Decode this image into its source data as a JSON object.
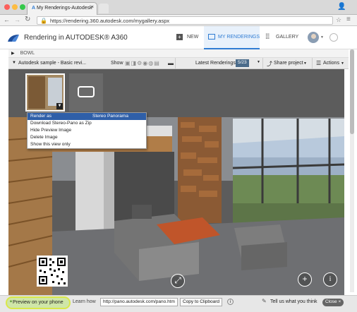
{
  "browser": {
    "tab_title": "My Renderings-Autodesk",
    "url": "https://rendering.360.autodesk.com/mygallery.aspx"
  },
  "app": {
    "title": "Rendering in AUTODESK® A360",
    "nav": {
      "new_label": "NEW",
      "my_renderings_label": "MY RENDERINGS",
      "gallery_label": "GALLERY"
    }
  },
  "project": {
    "name": "BOWL",
    "sample_label": "Autodesk sample - Basic revi...",
    "show_label": "Show",
    "latest_renderings_label": "Latest Renderings",
    "latest_count": "5/23",
    "share_label": "Share project",
    "actions_label": "Actions"
  },
  "context_menu": {
    "header_left": "Render as",
    "header_right": "Stereo Panorama",
    "items": [
      "Download Stereo-Pano as Zip",
      "Hide Preview Image",
      "Delete Image",
      "Show this view only"
    ]
  },
  "bottom": {
    "preview_label": "Preview on your phone",
    "learn_how": "Learn how",
    "pano_url": "http://pano.autodesk.com/pano.htm",
    "copy_label": "Copy to Clipboard",
    "feedback_label": "Tell us what you think",
    "close_label": "Close"
  },
  "icons": {
    "accent": "#2f7cd3",
    "menu_highlight": "#2f5fa8",
    "preview_highlight": "#d9e84a"
  }
}
